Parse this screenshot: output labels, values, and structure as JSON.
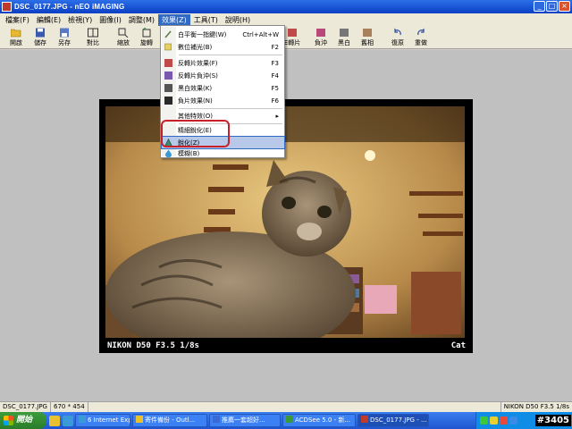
{
  "window": {
    "title": "DSC_0177.JPG - nEO iMAGING"
  },
  "menubar": {
    "items": [
      {
        "label": "檔案(F)"
      },
      {
        "label": "編輯(E)"
      },
      {
        "label": "檢視(Y)"
      },
      {
        "label": "圖像(I)"
      },
      {
        "label": "調整(M)"
      },
      {
        "label": "效果(Z)"
      },
      {
        "label": "工具(T)"
      },
      {
        "label": "說明(H)"
      }
    ]
  },
  "toolbar": {
    "items": [
      {
        "label": "開啟",
        "icon": "folder-open-icon"
      },
      {
        "label": "儲存",
        "icon": "save-icon"
      },
      {
        "label": "另存",
        "icon": "save-as-icon"
      },
      {
        "label": "對比",
        "icon": "compare-icon"
      },
      {
        "label": "縮放",
        "icon": "zoom-icon"
      },
      {
        "label": "旋轉",
        "icon": "rotate-icon"
      },
      {
        "label": "E轉片",
        "icon": "invert-icon"
      },
      {
        "label": "負沖",
        "icon": "negative-icon"
      },
      {
        "label": "黑白",
        "icon": "bw-icon"
      },
      {
        "label": "舊相",
        "icon": "old-photo-icon"
      },
      {
        "label": "復原",
        "icon": "undo-icon"
      },
      {
        "label": "重做",
        "icon": "redo-icon"
      }
    ]
  },
  "effects_menu": {
    "items": [
      {
        "label": "白平衡一指鍵(W)",
        "shortcut": "Ctrl+Alt+W",
        "icon": "white-balance-icon"
      },
      {
        "label": "數位補光(B)",
        "shortcut": "F2",
        "icon": "fill-light-icon"
      },
      {
        "label": "反轉片效果(F)",
        "shortcut": "F3",
        "icon": "reversal-film-icon"
      },
      {
        "label": "反轉片負沖(S)",
        "shortcut": "F4",
        "icon": "cross-process-icon"
      },
      {
        "label": "黑白效果(K)",
        "shortcut": "F5",
        "icon": "black-white-icon"
      },
      {
        "label": "負片效果(N)",
        "shortcut": "F6",
        "icon": "negative-film-icon"
      },
      {
        "label": "其他特效(O)",
        "shortcut": "▸",
        "icon": ""
      },
      {
        "label": "精細銳化(E)",
        "shortcut": "",
        "icon": ""
      },
      {
        "label": "銳化(Z)",
        "shortcut": "",
        "icon": "sharpen-icon"
      },
      {
        "label": "模糊(B)",
        "shortcut": "",
        "icon": "blur-icon"
      }
    ]
  },
  "photo": {
    "caption_left": "NIKON D50 F3.5 1/8s",
    "caption_right": "Cat"
  },
  "statusbar": {
    "filename": "DSC_0177.JPG",
    "dimensions": "670 * 454",
    "right_text": "NIKON D50 F3.5 1/8s"
  },
  "taskbar": {
    "start_label": "開始",
    "tasks": [
      {
        "label": "6 Internet Expl..."
      },
      {
        "label": "寄件備份 - Outl..."
      },
      {
        "label": "推薦一套超好..."
      },
      {
        "label": "ACDSee 5.0 - 新..."
      },
      {
        "label": "DSC_0177.JPG - ..."
      }
    ],
    "watermark": "#3405"
  },
  "colors": {
    "accent": "#316ac5",
    "highlight_outline": "#c91f28",
    "title_bar": "#0a3fc4"
  }
}
